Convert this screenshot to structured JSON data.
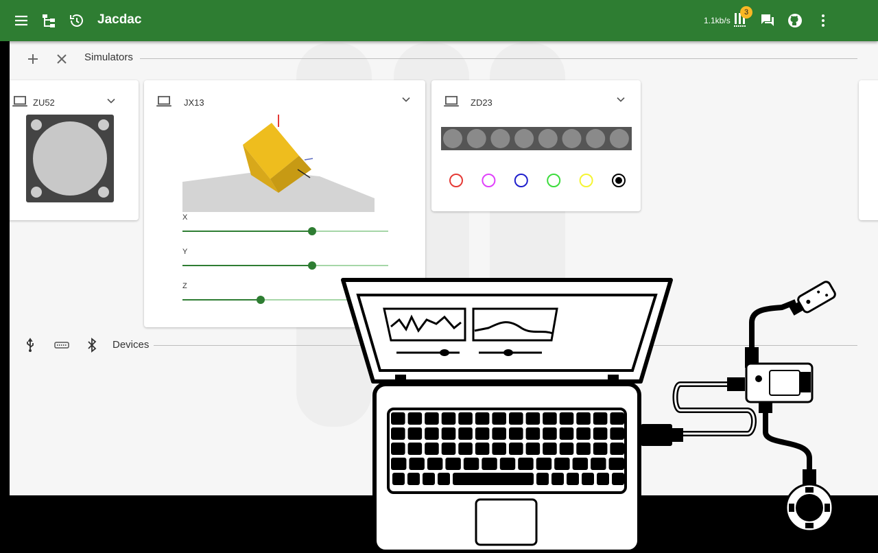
{
  "appbar": {
    "title": "Jacdac",
    "data_rate": "1.1kb/s",
    "notification_count": "3",
    "bg_color": "#2e7d32",
    "icons": [
      "menu-icon",
      "device-tree-icon",
      "history-icon",
      "transport-icon",
      "chat-icon",
      "github-icon",
      "more-vert-icon"
    ]
  },
  "simulators": {
    "label": "Simulators",
    "toolbar_icons": [
      "add-icon",
      "close-icon"
    ]
  },
  "cards": {
    "zu52": {
      "name": "ZU52",
      "device_icon": "laptop-icon"
    },
    "jx13": {
      "name": "JX13",
      "device_icon": "laptop-icon",
      "sliders": [
        {
          "label": "X",
          "value": 0.63
        },
        {
          "label": "Y",
          "value": 0.63
        },
        {
          "label": "Z",
          "value": 0.38
        }
      ]
    },
    "zd23": {
      "name": "ZD23",
      "device_icon": "laptop-icon",
      "led_count": 8,
      "color_options": [
        "#e53935",
        "#e040fb",
        "#1e1ecc",
        "#3cdc3c",
        "#f5f532",
        "#000000"
      ],
      "selected_color": "#000000"
    }
  },
  "devices": {
    "label": "Devices",
    "connect_icons": [
      "usb-icon",
      "serial-icon",
      "bluetooth-icon"
    ]
  }
}
